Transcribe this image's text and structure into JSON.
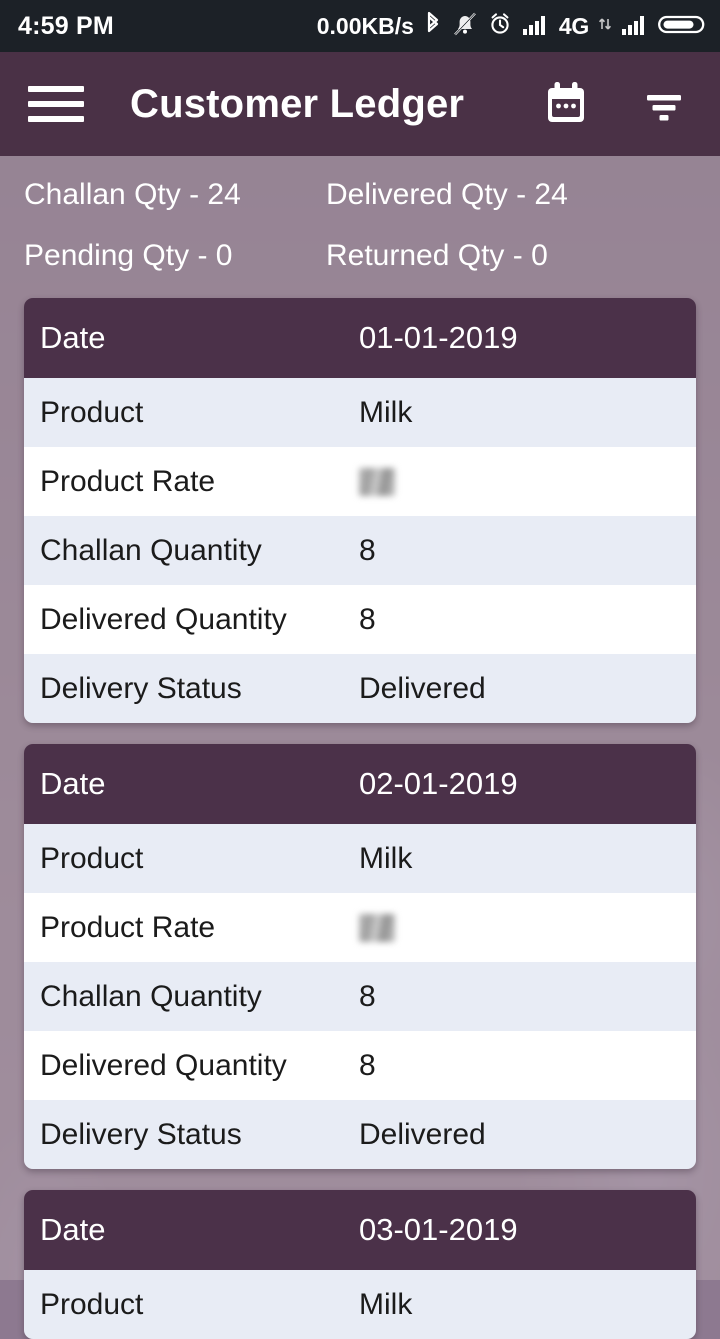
{
  "status_bar": {
    "clock": "4:59 PM",
    "network_speed": "0.00KB/s",
    "network_type": "4G",
    "icons": [
      "bluetooth-icon",
      "mute-bell-icon",
      "alarm-clock-icon",
      "signal-bars-icon",
      "data-transfer-icon",
      "signal-bars-2-icon",
      "battery-icon"
    ]
  },
  "app_bar": {
    "title": "Customer Ledger",
    "menu_icon": "hamburger-menu-icon",
    "calendar_icon": "calendar-icon",
    "filter_icon": "filter-icon"
  },
  "summary": {
    "challan_qty": "Challan Qty - 24",
    "delivered_qty": "Delivered Qty - 24",
    "pending_qty": "Pending Qty - 0",
    "returned_qty": "Returned Qty - 0"
  },
  "labels": {
    "date": "Date",
    "product": "Product",
    "product_rate": "Product Rate",
    "challan_quantity": "Challan Quantity",
    "delivered_quantity": "Delivered Quantity",
    "delivery_status": "Delivery Status"
  },
  "cards": [
    {
      "date": "01-01-2019",
      "product": "Milk",
      "product_rate": "",
      "challan_quantity": "8",
      "delivered_quantity": "8",
      "delivery_status": "Delivered"
    },
    {
      "date": "02-01-2019",
      "product": "Milk",
      "product_rate": "",
      "challan_quantity": "8",
      "delivered_quantity": "8",
      "delivery_status": "Delivered"
    },
    {
      "date": "03-01-2019",
      "product": "Milk"
    }
  ],
  "colors": {
    "app_bar": "#4a3146",
    "summary_band": "#8d7990",
    "card_header": "#4b3149",
    "row_alt": "#e8ecf5",
    "row_plain": "#ffffff",
    "status_bar": "#1c2127"
  }
}
